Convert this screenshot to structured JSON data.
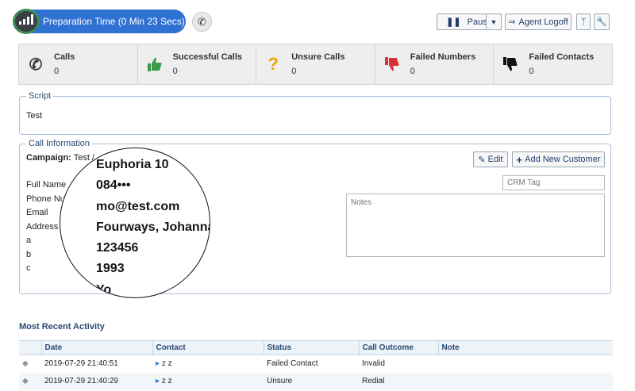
{
  "topbar": {
    "prep_label": "Preparation Time (0 Min 23 Secs)",
    "pause_label": "Pause",
    "logoff_label": "Agent Logoff"
  },
  "stats": [
    {
      "title": "Calls",
      "value": "0",
      "icon": "phone-icon",
      "color": "#3a3f45"
    },
    {
      "title": "Successful Calls",
      "value": "0",
      "icon": "thumbs-up-icon",
      "color": "#3a9b48"
    },
    {
      "title": "Unsure Calls",
      "value": "0",
      "icon": "question-icon",
      "color": "#f0a30a"
    },
    {
      "title": "Failed Numbers",
      "value": "0",
      "icon": "thumbs-down-icon",
      "color": "#d9313a"
    },
    {
      "title": "Failed Contacts",
      "value": "0",
      "icon": "thumbs-down-icon",
      "color": "#111111"
    }
  ],
  "script": {
    "legend": "Script",
    "text": "Test"
  },
  "call_info": {
    "legend": "Call Information",
    "campaign_label": "Campaign:",
    "campaign_value": "Test /",
    "fields": [
      "Full Name",
      "Phone Nu",
      "Email",
      "Address",
      "a",
      "b",
      "c"
    ],
    "edit_label": "Edit",
    "add_label": "Add New Customer",
    "crm_placeholder": "CRM Tag",
    "notes_placeholder": "Notes"
  },
  "magnifier": {
    "lines": [
      "Euphoria 10",
      "084•••",
      "mo@test.com",
      "Fourways, Johanna",
      "123456",
      "1993",
      "Yo"
    ]
  },
  "activity": {
    "title": "Most Recent Activity",
    "columns": [
      "Date",
      "Contact",
      "Status",
      "Call Outcome",
      "Note"
    ],
    "rows": [
      {
        "date": "2019-07-29 21:40:51",
        "contact": "z z",
        "status": "Failed Contact",
        "outcome": "Invalid",
        "note": ""
      },
      {
        "date": "2019-07-29 21:40:29",
        "contact": "z z",
        "status": "Unsure",
        "outcome": "Redial",
        "note": ""
      }
    ]
  }
}
